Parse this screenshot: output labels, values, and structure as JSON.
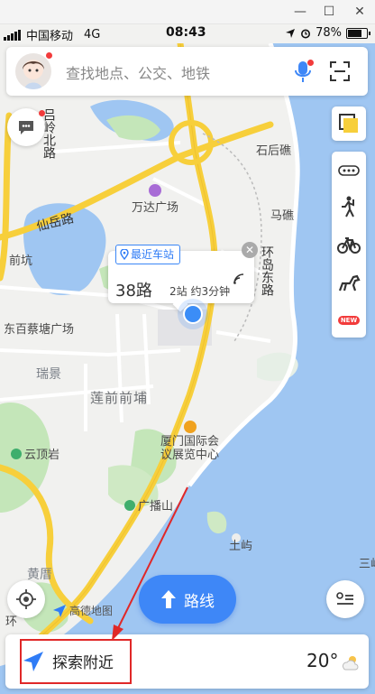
{
  "window_controls": {
    "minimize": "—",
    "maximize": "☐",
    "close": "✕"
  },
  "status_bar": {
    "carrier": "中国移动",
    "network": "4G",
    "time": "08:43",
    "battery_percent": "78%",
    "battery_level": 0.78
  },
  "search": {
    "placeholder": "查找地点、公交、地铁",
    "mic_icon": "microphone-icon",
    "scan_icon": "scan-icon"
  },
  "bus_popup": {
    "tag": "最近车站",
    "line": "38路",
    "info": "2站 约3分钟"
  },
  "map_labels": {
    "road_xianyue": "仙岳路",
    "road_xiahuan": "环岛东路",
    "road_lvling": "吕岭北路",
    "wanda": "万达广场",
    "shihoujiao": "石后礁",
    "majiao": "马礁",
    "qiankeng": "前坑",
    "caitang": "东百蔡塘广场",
    "ruijing": "瑞景",
    "lianqian": "莲前前埔",
    "xiamen_center": "厦门国际会议展览中心",
    "center_line1": "厦门国际会",
    "center_line2": "议展览中心",
    "yunding": "云顶岩",
    "guangbo": "广播山",
    "tuyu": "土屿",
    "huangcuo": "黄厝",
    "sanxu": "三屿",
    "huan": "环"
  },
  "logo": {
    "text": "高德地图"
  },
  "route_button": {
    "label": "路线"
  },
  "bottom": {
    "explore_label": "探索附近",
    "temperature": "20°"
  },
  "colors": {
    "accent": "#3e87f7",
    "sea": "#9fc6f2",
    "road_yellow": "#f7cf3b",
    "green": "#c4e6b9",
    "annotation_red": "#e02828"
  }
}
